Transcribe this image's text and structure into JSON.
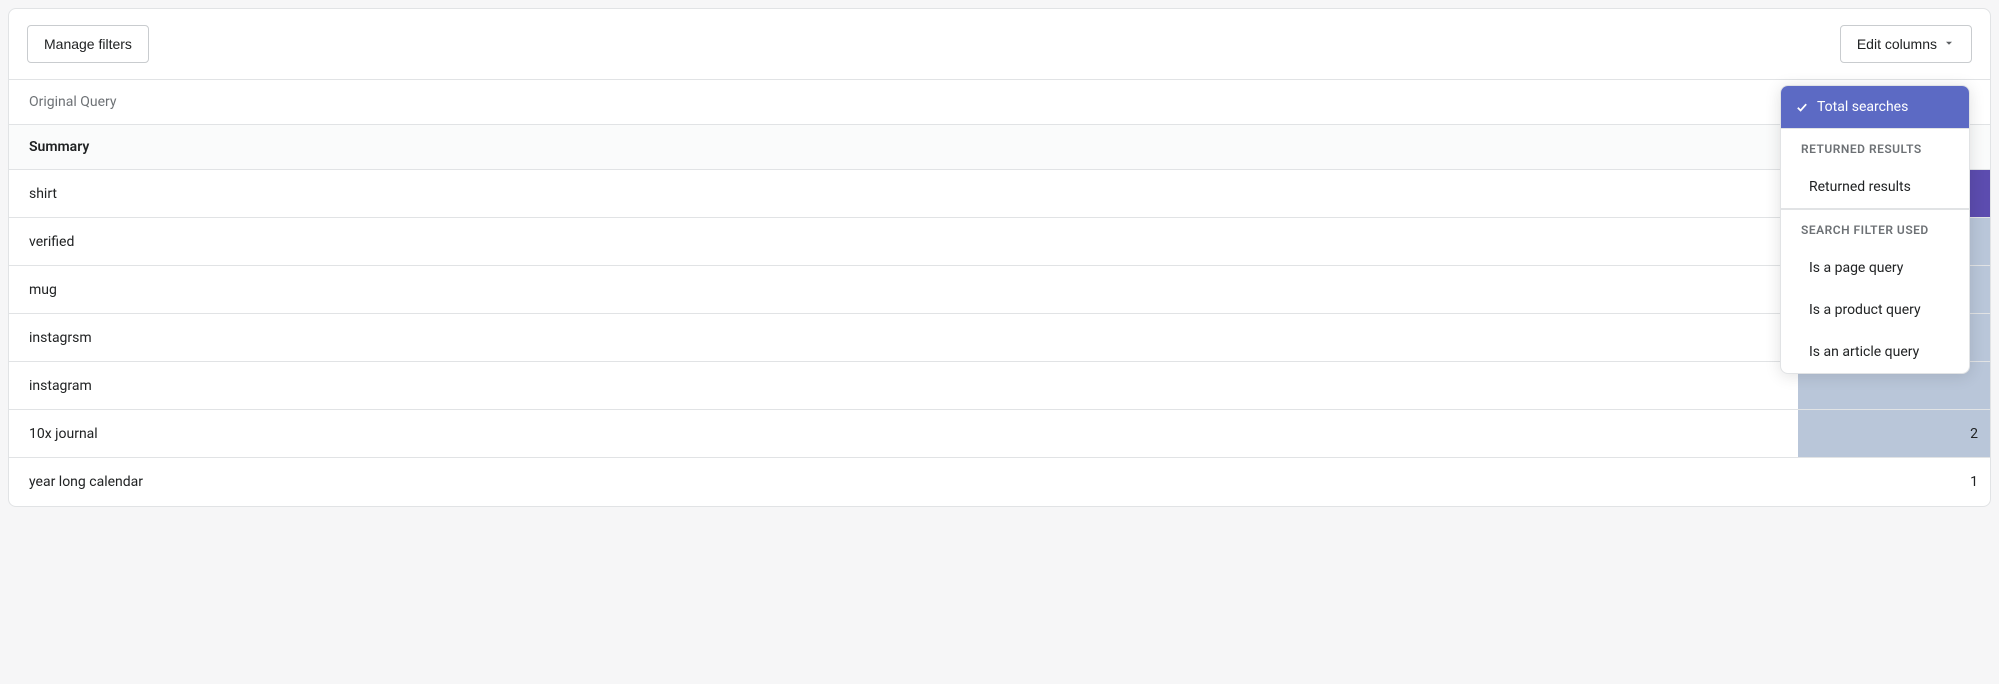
{
  "toolbar": {
    "manage_filters_label": "Manage filters",
    "edit_columns_label": "Edit columns"
  },
  "table": {
    "header": "Original Query",
    "summary_label": "Summary",
    "rows": [
      {
        "query": "shirt",
        "highlight": "dark",
        "value": ""
      },
      {
        "query": "verified",
        "highlight": "light",
        "value": ""
      },
      {
        "query": "mug",
        "highlight": "light",
        "value": ""
      },
      {
        "query": "instagrsm",
        "highlight": "light",
        "value": ""
      },
      {
        "query": "instagram",
        "highlight": "light",
        "value": ""
      },
      {
        "query": "10x journal",
        "highlight": "light",
        "value": "2"
      },
      {
        "query": "year long calendar",
        "highlight": "none",
        "value": "1"
      }
    ]
  },
  "dropdown": {
    "selected_item": "Total searches",
    "sections": {
      "returned_results": {
        "header": "RETURNED RESULTS",
        "items": [
          "Returned results"
        ]
      },
      "search_filter_used": {
        "header": "SEARCH FILTER USED",
        "items": [
          "Is a page query",
          "Is a product query",
          "Is an article query"
        ]
      }
    }
  }
}
